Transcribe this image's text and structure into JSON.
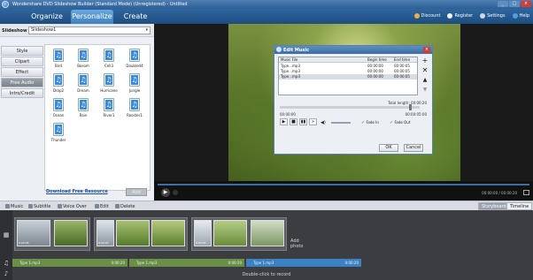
{
  "window": {
    "title": "Wondershare DVD Slideshow Builder (Standard Mode) (Unregistered) - Untitled",
    "buttons": [
      "_",
      "□",
      "×"
    ]
  },
  "tabs": [
    "Organize",
    "Personalize",
    "Create"
  ],
  "active_tab": "Personalize",
  "top_links": {
    "discount": "Discount",
    "register": "Register",
    "settings": "Settings",
    "help": "Help"
  },
  "slideshow": {
    "label": "Slideshow list:",
    "value": "Slideshow1",
    "arrow": "▾"
  },
  "categories": [
    {
      "label": "Style",
      "active": false
    },
    {
      "label": "Clipart",
      "active": false
    },
    {
      "label": "Effect",
      "active": false
    },
    {
      "label": "Free Audio",
      "active": true
    },
    {
      "label": "Intro/Credit",
      "active": false
    }
  ],
  "music_files": [
    "Bird",
    "Bosom",
    "Cell3",
    "Doubled4",
    "Drop2",
    "Dream",
    "Hurricane",
    "Jungle",
    "Ocean",
    "Rain",
    "River1",
    "Rooster1",
    "Thunder"
  ],
  "download_link": "Download Free Resource",
  "add_button": "Add",
  "player": {
    "time": "00:00:00 / 00:00:20",
    "play_glyph": "▶"
  },
  "dialog": {
    "title": "Edit Music",
    "close": "×",
    "columns": [
      "Music File",
      "Begin time",
      "End time"
    ],
    "rows": [
      {
        "file": "Type...mp3",
        "begin": "00:00:00",
        "end": "00:00:05",
        "selected": false
      },
      {
        "file": "Type...mp3",
        "begin": "00:00:00",
        "end": "00:00:05",
        "selected": false
      },
      {
        "file": "Type...mp3",
        "begin": "00:00:00",
        "end": "00:00:05",
        "selected": true
      }
    ],
    "side_buttons": [
      "+",
      "✕",
      "▲",
      "▼"
    ],
    "total_length": "Total length: 00:00:20",
    "time_start": "00:00:00",
    "time_end": "00:00:05:00",
    "seek_fraction": 0.94,
    "ctrl_glyphs": [
      "▶",
      "■",
      "▮▮",
      "»"
    ],
    "volume_glyph": "◀)",
    "fade_in": "Fade In",
    "fade_out": "Fade Out",
    "check": "✓",
    "ok": "OK",
    "cancel": "Cancel"
  },
  "toolbar": {
    "items": [
      "Music",
      "Subtitle",
      "Voice Over",
      "Edit",
      "Delete"
    ],
    "view_tabs": [
      "Storyboard",
      "Timeline"
    ],
    "active_view": "Storyboard"
  },
  "storyboard": {
    "add_photo": "Add photo",
    "thumb_time": "0:00:05",
    "audio_clips": [
      {
        "name": "Type 1.mp3",
        "duration": "0:00:20"
      },
      {
        "name": "Type 1.mp3",
        "duration": "0:00:20"
      },
      {
        "name": "Type 1.mp3",
        "duration": "0:00:20"
      }
    ],
    "record_hint": "Double-click to record",
    "track_icons": [
      "▦",
      "♫",
      "♪"
    ]
  },
  "colors": {
    "accent": "#3f80bf",
    "audio_green": "#6a8f46",
    "audio_blue": "#3b82c4"
  }
}
